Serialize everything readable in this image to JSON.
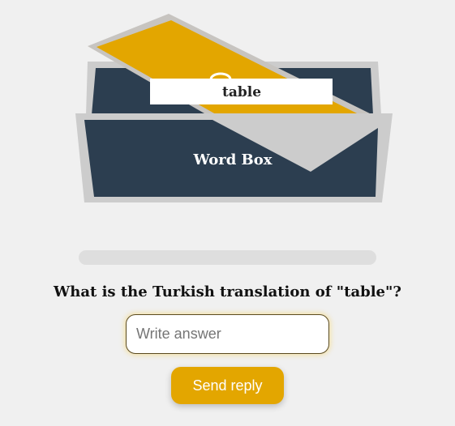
{
  "card": {
    "word": "table",
    "box_label": "Word Box"
  },
  "progress": {
    "fraction": 0
  },
  "question": {
    "text": "What is the Turkish translation of \"table\"?"
  },
  "answer": {
    "placeholder": "Write answer",
    "value": ""
  },
  "actions": {
    "send_label": "Send reply"
  },
  "colors": {
    "box_body": "#2c3e50",
    "box_frame": "#cccccc",
    "card_gold": "#e3a600",
    "button": "#e3a600",
    "background": "#f0f0f0"
  }
}
